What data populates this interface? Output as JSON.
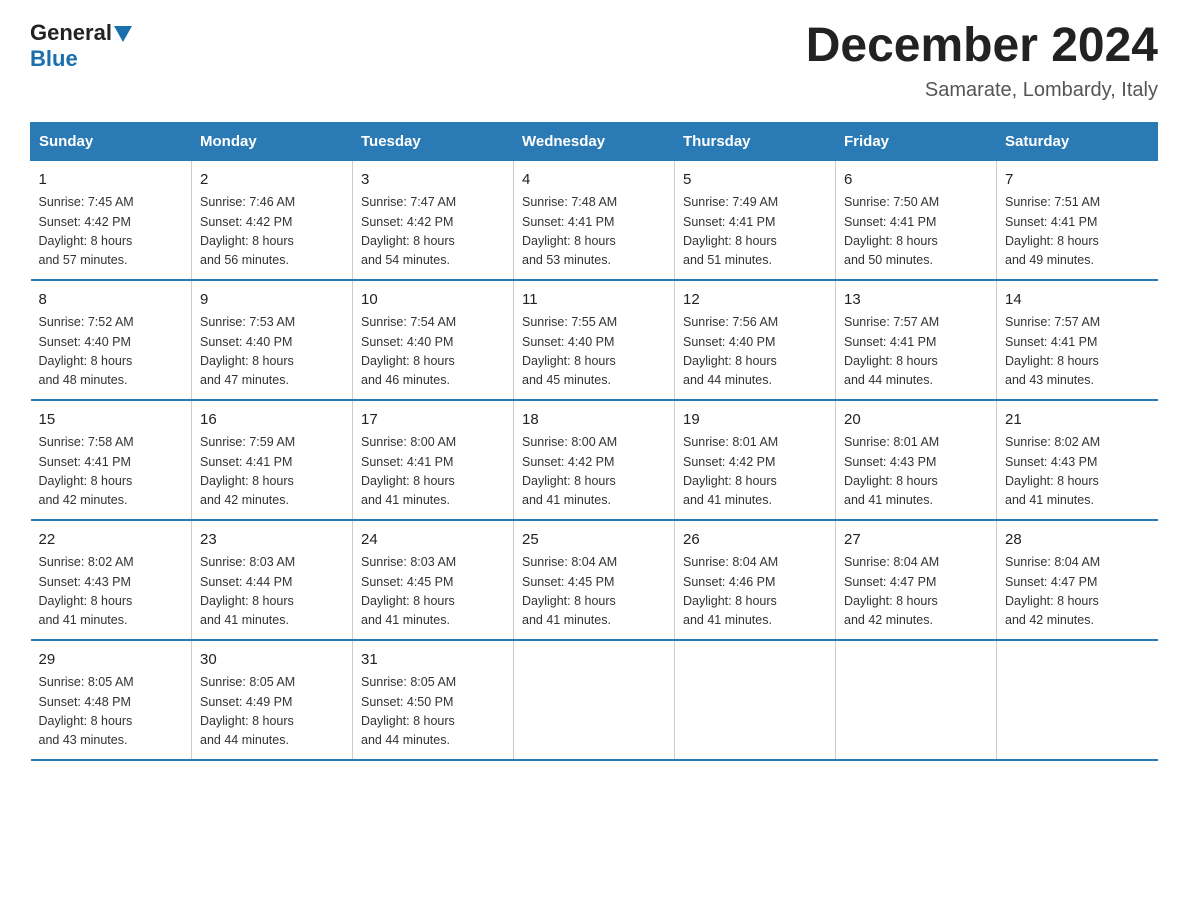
{
  "logo": {
    "general": "General",
    "blue": "Blue"
  },
  "title": "December 2024",
  "subtitle": "Samarate, Lombardy, Italy",
  "days_of_week": [
    "Sunday",
    "Monday",
    "Tuesday",
    "Wednesday",
    "Thursday",
    "Friday",
    "Saturday"
  ],
  "weeks": [
    [
      {
        "day": "1",
        "sunrise": "7:45 AM",
        "sunset": "4:42 PM",
        "daylight": "8 hours and 57 minutes."
      },
      {
        "day": "2",
        "sunrise": "7:46 AM",
        "sunset": "4:42 PM",
        "daylight": "8 hours and 56 minutes."
      },
      {
        "day": "3",
        "sunrise": "7:47 AM",
        "sunset": "4:42 PM",
        "daylight": "8 hours and 54 minutes."
      },
      {
        "day": "4",
        "sunrise": "7:48 AM",
        "sunset": "4:41 PM",
        "daylight": "8 hours and 53 minutes."
      },
      {
        "day": "5",
        "sunrise": "7:49 AM",
        "sunset": "4:41 PM",
        "daylight": "8 hours and 51 minutes."
      },
      {
        "day": "6",
        "sunrise": "7:50 AM",
        "sunset": "4:41 PM",
        "daylight": "8 hours and 50 minutes."
      },
      {
        "day": "7",
        "sunrise": "7:51 AM",
        "sunset": "4:41 PM",
        "daylight": "8 hours and 49 minutes."
      }
    ],
    [
      {
        "day": "8",
        "sunrise": "7:52 AM",
        "sunset": "4:40 PM",
        "daylight": "8 hours and 48 minutes."
      },
      {
        "day": "9",
        "sunrise": "7:53 AM",
        "sunset": "4:40 PM",
        "daylight": "8 hours and 47 minutes."
      },
      {
        "day": "10",
        "sunrise": "7:54 AM",
        "sunset": "4:40 PM",
        "daylight": "8 hours and 46 minutes."
      },
      {
        "day": "11",
        "sunrise": "7:55 AM",
        "sunset": "4:40 PM",
        "daylight": "8 hours and 45 minutes."
      },
      {
        "day": "12",
        "sunrise": "7:56 AM",
        "sunset": "4:40 PM",
        "daylight": "8 hours and 44 minutes."
      },
      {
        "day": "13",
        "sunrise": "7:57 AM",
        "sunset": "4:41 PM",
        "daylight": "8 hours and 44 minutes."
      },
      {
        "day": "14",
        "sunrise": "7:57 AM",
        "sunset": "4:41 PM",
        "daylight": "8 hours and 43 minutes."
      }
    ],
    [
      {
        "day": "15",
        "sunrise": "7:58 AM",
        "sunset": "4:41 PM",
        "daylight": "8 hours and 42 minutes."
      },
      {
        "day": "16",
        "sunrise": "7:59 AM",
        "sunset": "4:41 PM",
        "daylight": "8 hours and 42 minutes."
      },
      {
        "day": "17",
        "sunrise": "8:00 AM",
        "sunset": "4:41 PM",
        "daylight": "8 hours and 41 minutes."
      },
      {
        "day": "18",
        "sunrise": "8:00 AM",
        "sunset": "4:42 PM",
        "daylight": "8 hours and 41 minutes."
      },
      {
        "day": "19",
        "sunrise": "8:01 AM",
        "sunset": "4:42 PM",
        "daylight": "8 hours and 41 minutes."
      },
      {
        "day": "20",
        "sunrise": "8:01 AM",
        "sunset": "4:43 PM",
        "daylight": "8 hours and 41 minutes."
      },
      {
        "day": "21",
        "sunrise": "8:02 AM",
        "sunset": "4:43 PM",
        "daylight": "8 hours and 41 minutes."
      }
    ],
    [
      {
        "day": "22",
        "sunrise": "8:02 AM",
        "sunset": "4:43 PM",
        "daylight": "8 hours and 41 minutes."
      },
      {
        "day": "23",
        "sunrise": "8:03 AM",
        "sunset": "4:44 PM",
        "daylight": "8 hours and 41 minutes."
      },
      {
        "day": "24",
        "sunrise": "8:03 AM",
        "sunset": "4:45 PM",
        "daylight": "8 hours and 41 minutes."
      },
      {
        "day": "25",
        "sunrise": "8:04 AM",
        "sunset": "4:45 PM",
        "daylight": "8 hours and 41 minutes."
      },
      {
        "day": "26",
        "sunrise": "8:04 AM",
        "sunset": "4:46 PM",
        "daylight": "8 hours and 41 minutes."
      },
      {
        "day": "27",
        "sunrise": "8:04 AM",
        "sunset": "4:47 PM",
        "daylight": "8 hours and 42 minutes."
      },
      {
        "day": "28",
        "sunrise": "8:04 AM",
        "sunset": "4:47 PM",
        "daylight": "8 hours and 42 minutes."
      }
    ],
    [
      {
        "day": "29",
        "sunrise": "8:05 AM",
        "sunset": "4:48 PM",
        "daylight": "8 hours and 43 minutes."
      },
      {
        "day": "30",
        "sunrise": "8:05 AM",
        "sunset": "4:49 PM",
        "daylight": "8 hours and 44 minutes."
      },
      {
        "day": "31",
        "sunrise": "8:05 AM",
        "sunset": "4:50 PM",
        "daylight": "8 hours and 44 minutes."
      },
      null,
      null,
      null,
      null
    ]
  ],
  "labels": {
    "sunrise": "Sunrise:",
    "sunset": "Sunset:",
    "daylight": "Daylight:"
  }
}
